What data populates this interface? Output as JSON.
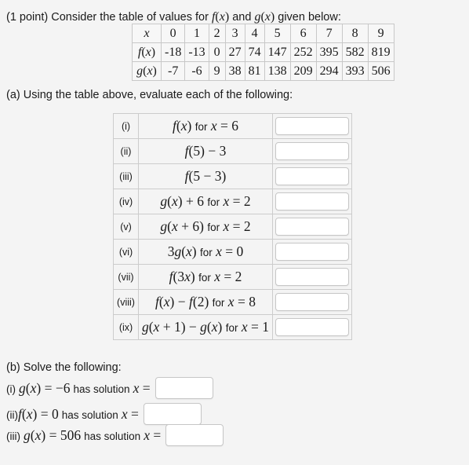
{
  "problem": {
    "points_label": "(1 point)",
    "intro_text_before": "Consider the table of values for",
    "intro_fx": "f(x)",
    "intro_and": "and",
    "intro_gx": "g(x)",
    "intro_text_after": "given below:"
  },
  "values_table": {
    "row_labels": [
      "x",
      "f(x)",
      "g(x)"
    ],
    "x": [
      "0",
      "1",
      "2",
      "3",
      "4",
      "5",
      "6",
      "7",
      "8",
      "9"
    ],
    "f": [
      "-18",
      "-13",
      "0",
      "27",
      "74",
      "147",
      "252",
      "395",
      "582",
      "819"
    ],
    "g": [
      "-7",
      "-6",
      "9",
      "38",
      "81",
      "138",
      "209",
      "294",
      "393",
      "506"
    ]
  },
  "part_a": {
    "label": "(a) Using the table above, evaluate each of the following:",
    "rows": [
      {
        "num": "(i)",
        "expr_html": "<span class=\"mi\">f</span><span class=\"mo\">(</span><span class=\"mi\">x</span><span class=\"mo\">)</span> <span class=\"mtxt\">for</span> <span class=\"mi\">x</span> <span class=\"mo\">=</span> <span class=\"mn\">6</span>",
        "expr_text": "f(x) for x = 6",
        "answer": ""
      },
      {
        "num": "(ii)",
        "expr_html": "<span class=\"mi\">f</span><span class=\"mo\">(</span><span class=\"mn\">5</span><span class=\"mo\">)</span> <span class=\"mo\">&#8722;</span> <span class=\"mn\">3</span>",
        "expr_text": "f(5) - 3",
        "answer": ""
      },
      {
        "num": "(iii)",
        "expr_html": "<span class=\"mi\">f</span><span class=\"mo\">(</span><span class=\"mn\">5</span> <span class=\"mo\">&#8722;</span> <span class=\"mn\">3</span><span class=\"mo\">)</span>",
        "expr_text": "f(5 - 3)",
        "answer": ""
      },
      {
        "num": "(iv)",
        "expr_html": "<span class=\"mi\">g</span><span class=\"mo\">(</span><span class=\"mi\">x</span><span class=\"mo\">)</span> <span class=\"mo\">+</span> <span class=\"mn\">6</span> <span class=\"mtxt\">for</span> <span class=\"mi\">x</span> <span class=\"mo\">=</span> <span class=\"mn\">2</span>",
        "expr_text": "g(x) + 6 for x = 2",
        "answer": ""
      },
      {
        "num": "(v)",
        "expr_html": "<span class=\"mi\">g</span><span class=\"mo\">(</span><span class=\"mi\">x</span> <span class=\"mo\">+</span> <span class=\"mn\">6</span><span class=\"mo\">)</span> <span class=\"mtxt\">for</span> <span class=\"mi\">x</span> <span class=\"mo\">=</span> <span class=\"mn\">2</span>",
        "expr_text": "g(x + 6) for x = 2",
        "answer": ""
      },
      {
        "num": "(vi)",
        "expr_html": "<span class=\"mn\">3</span><span class=\"mi\">g</span><span class=\"mo\">(</span><span class=\"mi\">x</span><span class=\"mo\">)</span> <span class=\"mtxt\">for</span> <span class=\"mi\">x</span> <span class=\"mo\">=</span> <span class=\"mn\">0</span>",
        "expr_text": "3g(x) for x = 0",
        "answer": ""
      },
      {
        "num": "(vii)",
        "expr_html": "<span class=\"mi\">f</span><span class=\"mo\">(</span><span class=\"mn\">3</span><span class=\"mi\">x</span><span class=\"mo\">)</span> <span class=\"mtxt\">for</span> <span class=\"mi\">x</span> <span class=\"mo\">=</span> <span class=\"mn\">2</span>",
        "expr_text": "f(3x) for x = 2",
        "answer": ""
      },
      {
        "num": "(viii)",
        "expr_html": "<span class=\"mi\">f</span><span class=\"mo\">(</span><span class=\"mi\">x</span><span class=\"mo\">)</span> <span class=\"mo\">&#8722;</span> <span class=\"mi\">f</span><span class=\"mo\">(</span><span class=\"mn\">2</span><span class=\"mo\">)</span> <span class=\"mtxt\">for</span> <span class=\"mi\">x</span> <span class=\"mo\">=</span> <span class=\"mn\">8</span>",
        "expr_text": "f(x) - f(2) for x = 8",
        "answer": ""
      },
      {
        "num": "(ix)",
        "expr_html": "<span class=\"mi\">g</span><span class=\"mo\">(</span><span class=\"mi\">x</span> <span class=\"mo\">+</span> <span class=\"mn\">1</span><span class=\"mo\">)</span> <span class=\"mo\">&#8722;</span> <span class=\"mi\">g</span><span class=\"mo\">(</span><span class=\"mi\">x</span><span class=\"mo\">)</span> <span class=\"mtxt\">for</span> <span class=\"mi\">x</span> <span class=\"mo\">=</span> <span class=\"mn\">1</span>",
        "expr_text": "g(x + 1) - g(x) for x = 1",
        "answer": ""
      }
    ]
  },
  "part_b": {
    "label": "(b) Solve the following:",
    "rows": [
      {
        "label_html": "<span class=\"mtxt\">(i)</span> <span class=\"math\"><span class=\"mi\">g</span><span class=\"mo\">(</span><span class=\"mi\">x</span><span class=\"mo\">)</span> <span class=\"mo\">=</span> <span class=\"mo\">&#8722;</span><span class=\"mn\">6</span></span> <span class=\"mtxt\">has solution</span> <span class=\"math\"><span class=\"mi\">x</span> <span class=\"mo\">=</span></span>",
        "label_text": "(i) g(x) = -6 has solution x =",
        "answer": ""
      },
      {
        "label_html": "<span class=\"mtxt\">(ii)</span><span class=\"math\"><span class=\"mi\">f</span><span class=\"mo\">(</span><span class=\"mi\">x</span><span class=\"mo\">)</span> <span class=\"mo\">=</span> <span class=\"mn\">0</span></span> <span class=\"mtxt\">has solution</span> <span class=\"math\"><span class=\"mi\">x</span> <span class=\"mo\">=</span></span>",
        "label_text": "(ii) f(x) = 0 has solution x =",
        "answer": ""
      },
      {
        "label_html": "<span class=\"mtxt\">(iii)</span> <span class=\"math\"><span class=\"mi\">g</span><span class=\"mo\">(</span><span class=\"mi\">x</span><span class=\"mo\">)</span> <span class=\"mo\">=</span> <span class=\"mn\">506</span></span> <span class=\"mtxt\">has solution</span> <span class=\"math\"><span class=\"mi\">x</span> <span class=\"mo\">=</span></span>",
        "label_text": "(iii) g(x) = 506 has solution x =",
        "answer": ""
      }
    ]
  },
  "colors": {
    "page_background": "#f4f4f4",
    "table_border": "#33343a",
    "cell_border": "#cccccc",
    "input_background": "#ffffff",
    "input_border": "#c6c6c6",
    "text": "#1a1a1a"
  }
}
